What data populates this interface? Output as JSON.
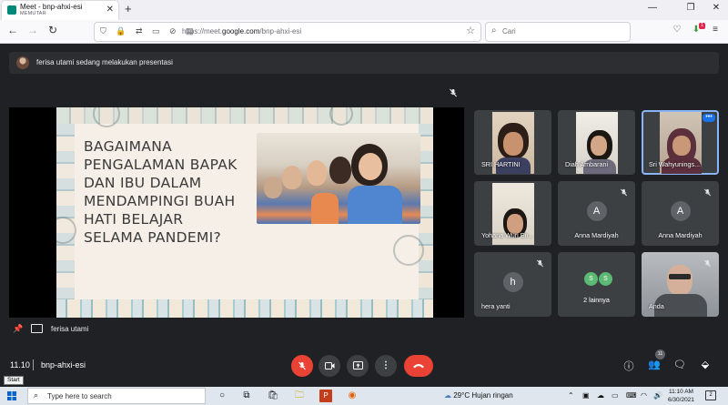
{
  "browser": {
    "tab_title": "Meet - bnp-ahxi-esi",
    "tab_subtitle": "MEMUTAR",
    "url_prefix": "https://meet.",
    "url_domain": "google.com",
    "url_path": "/bnp-ahxi-esi",
    "search_placeholder": "Cari",
    "extension_badge": "1"
  },
  "meet": {
    "banner_text": "ferisa utami sedang melakukan presentasi",
    "slide": {
      "title": "BAGAIMANA\nPENGALAMAN BAPAK\nDAN IBU DALAM\nMENDAMPINGI BUAH\nHATI BELAJAR\nSELAMA PANDEMI?"
    },
    "presenter_name": "ferisa utami",
    "participants": [
      {
        "name": "SRI HARTINI",
        "type": "video",
        "muted": false
      },
      {
        "name": "Diah Ambarani",
        "type": "video",
        "muted": false
      },
      {
        "name": "Sri Wahyunings...",
        "type": "video",
        "muted": false,
        "active": true
      },
      {
        "name": "Yohana Wuri En...",
        "type": "video",
        "muted": false
      },
      {
        "name": "Anna Mardiyah",
        "type": "avatar",
        "initial": "A",
        "color": "#5f6368",
        "muted": true
      },
      {
        "name": "Anna Mardiyah",
        "type": "avatar",
        "initial": "A",
        "color": "#5f6368",
        "muted": true
      },
      {
        "name": "hera yanti",
        "type": "avatar",
        "initial": "h",
        "color": "#5f6368",
        "muted": true
      },
      {
        "name": "2 lainnya",
        "type": "others",
        "initials": [
          "S",
          "S"
        ],
        "color": "#5bb974"
      },
      {
        "name": "Anda",
        "type": "video",
        "muted": true
      }
    ],
    "time": "11.10",
    "meeting_code": "bnp-ahxi-esi",
    "people_count": "11",
    "colors": {
      "background": "#202124",
      "tile": "#3c4043",
      "danger": "#ea4335",
      "accent": "#8ab4f8"
    }
  },
  "taskbar": {
    "start_tooltip": "Start",
    "search_placeholder": "Type here to search",
    "weather": "29°C  Hujan ringan",
    "clock_time": "11:10 AM",
    "clock_date": "6/30/2021",
    "notification_count": "2"
  }
}
